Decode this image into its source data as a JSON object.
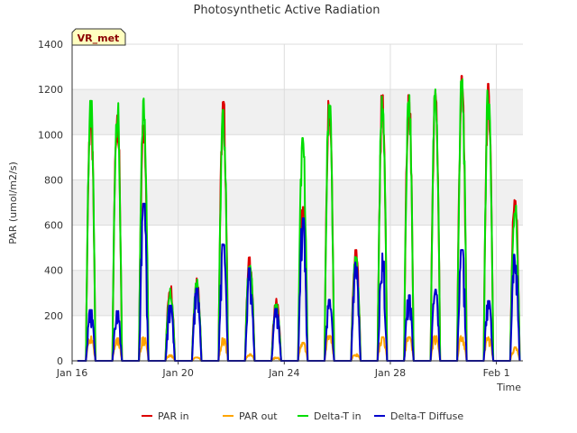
{
  "chart_data": {
    "type": "line",
    "title": "Photosynthetic Active Radiation",
    "xlabel": "Time",
    "ylabel": "PAR (umol/m2/s)",
    "badge": "VR_met",
    "x_start": "2024-01-16",
    "x_end": "2024-02-02",
    "xlim": [
      "2024-01-16",
      "2024-02-02"
    ],
    "ylim": [
      0,
      1400
    ],
    "yticks": [
      0,
      200,
      400,
      600,
      800,
      1000,
      1200,
      1400
    ],
    "xticks": [
      {
        "date": "2024-01-16",
        "label": "Jan 16"
      },
      {
        "date": "2024-01-20",
        "label": "Jan 20"
      },
      {
        "date": "2024-01-24",
        "label": "Jan 24"
      },
      {
        "date": "2024-01-28",
        "label": "Jan 28"
      },
      {
        "date": "2024-02-01",
        "label": "Feb 1"
      }
    ],
    "grid": true,
    "legend_position": "bottom",
    "series": [
      {
        "name": "PAR in",
        "color": "#dd0000",
        "daily_peaks": [
          1110,
          1120,
          1050,
          340,
          365,
          1145,
          460,
          275,
          680,
          1165,
          490,
          1175,
          1175,
          1195,
          1260,
          1225,
          760
        ]
      },
      {
        "name": "PAR out",
        "color": "#ffa500",
        "daily_peaks": [
          110,
          100,
          105,
          25,
          15,
          100,
          30,
          15,
          80,
          110,
          30,
          105,
          105,
          110,
          110,
          105,
          60
        ]
      },
      {
        "name": "Delta-T in",
        "color": "#00dd00",
        "daily_peaks": [
          1150,
          1140,
          1160,
          320,
          360,
          1110,
          440,
          250,
          985,
          1180,
          460,
          1170,
          1175,
          1200,
          1245,
          1210,
          700
        ]
      },
      {
        "name": "Delta-T Diffuse",
        "color": "#0000cc",
        "daily_peaks": [
          225,
          220,
          695,
          245,
          320,
          515,
          410,
          230,
          630,
          270,
          435,
          475,
          290,
          315,
          490,
          265,
          470
        ]
      }
    ]
  }
}
